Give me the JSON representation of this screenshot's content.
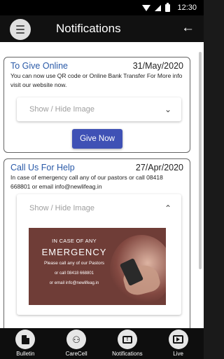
{
  "status_bar": {
    "time": "12:30",
    "icons": [
      "wifi-icon",
      "signal-icon",
      "battery-icon"
    ]
  },
  "app_bar": {
    "title": "Notifications",
    "menu_icon": "hamburger-menu-icon",
    "back_icon": "arrow-back-icon",
    "back_glyph": "←"
  },
  "notifications": [
    {
      "title": "To Give Online",
      "date": "31/May/2020",
      "body": "You can now use QR code or Online Bank Transfer For More info visit our website now.",
      "toggle_label": "Show / Hide Image",
      "toggle_glyph": "⌄",
      "button_label": "Give Now"
    },
    {
      "title": "Call Us For Help",
      "date": "27/Apr/2020",
      "body": "In case of emergency call any of our pastors or call 08418 668801 or email info@newlifeag.in",
      "toggle_label": "Show / Hide Image",
      "toggle_glyph": "⌃",
      "image": {
        "line1": "IN CASE OF ANY",
        "line2": "EMERGENCY",
        "line3": "Please call any of our Pastors",
        "line4": "or call 08418 668801",
        "line5": "or email info@newlifeag.in"
      }
    }
  ],
  "bottom_nav": [
    {
      "label": "Bulletin",
      "icon": "document-icon"
    },
    {
      "label": "CareCell",
      "icon": "people-icon",
      "glyph": "⚇"
    },
    {
      "label": "Notifications",
      "icon": "notification-message-icon",
      "glyph": "!"
    },
    {
      "label": "Live",
      "icon": "play-icon"
    }
  ],
  "colors": {
    "accent": "#3f51b5",
    "title_blue": "#2a5aa8",
    "app_bar": "#111111"
  }
}
